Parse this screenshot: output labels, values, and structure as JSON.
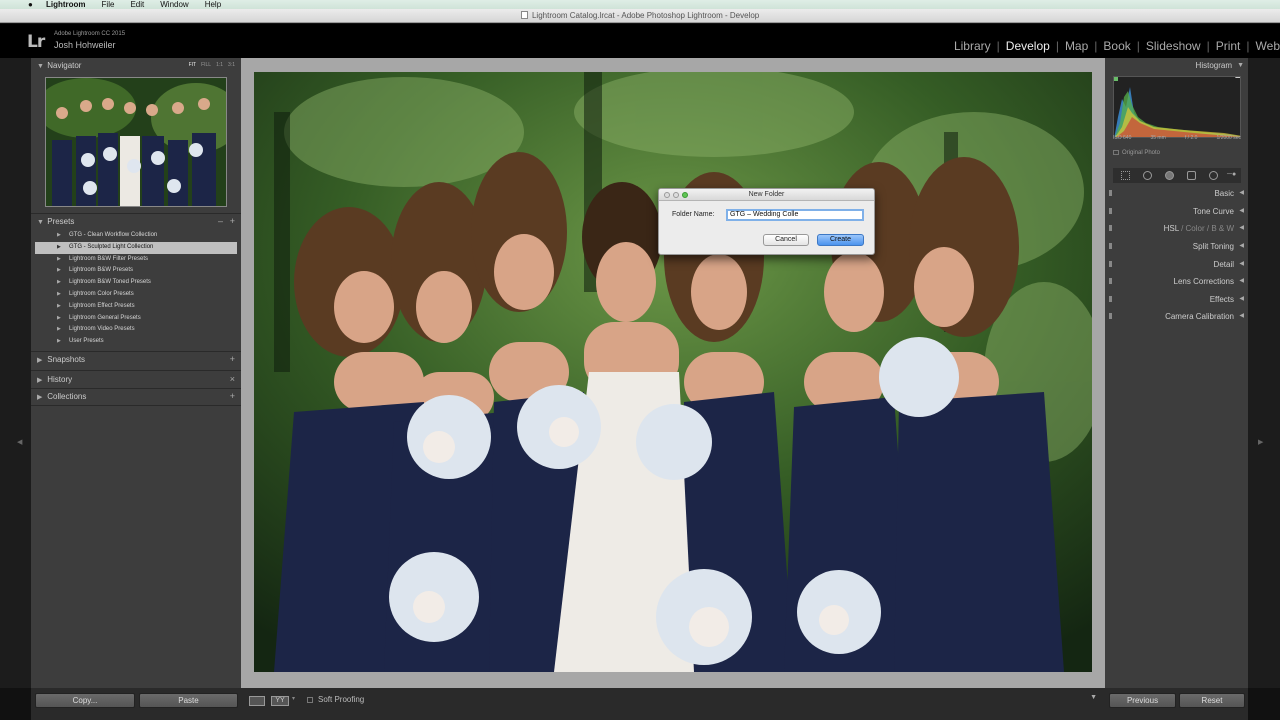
{
  "menubar": {
    "apple": "",
    "app": "Lightroom",
    "items": [
      "File",
      "Edit",
      "Window",
      "Help"
    ]
  },
  "window": {
    "title": "Lightroom Catalog.lrcat - Adobe Photoshop Lightroom - Develop"
  },
  "identity": {
    "logo": "Lr",
    "product": "Adobe Lightroom CC 2015",
    "user": "Josh Hohweiler"
  },
  "modules": [
    "Library",
    "Develop",
    "Map",
    "Book",
    "Slideshow",
    "Print",
    "Web"
  ],
  "active_module": "Develop",
  "left_panel": {
    "navigator": {
      "title": "Navigator",
      "zoom": [
        "FIT",
        "FILL",
        "1:1",
        "3:1"
      ]
    },
    "presets": {
      "title": "Presets",
      "minus": "–",
      "plus": "+",
      "items": [
        {
          "label": "GTG - Clean Workflow Collection"
        },
        {
          "label": "GTG - Sculpted Light Collection",
          "selected": true
        },
        {
          "label": "Lightroom B&W Filter Presets"
        },
        {
          "label": "Lightroom B&W Presets"
        },
        {
          "label": "Lightroom B&W Toned Presets"
        },
        {
          "label": "Lightroom Color Presets"
        },
        {
          "label": "Lightroom Effect Presets"
        },
        {
          "label": "Lightroom General Presets"
        },
        {
          "label": "Lightroom Video Presets"
        },
        {
          "label": "User Presets"
        }
      ]
    },
    "snapshots": {
      "title": "Snapshots",
      "action": "+"
    },
    "history": {
      "title": "History",
      "action": "×"
    },
    "collections": {
      "title": "Collections",
      "action": "+"
    },
    "copy_button": "Copy...",
    "paste_button": "Paste"
  },
  "toolbar": {
    "view_icon": "loupe-view-icon",
    "compare_icon": "before-after-icon",
    "compare_label": "YY",
    "soft_proofing": "Soft Proofing"
  },
  "right_panel": {
    "histogram": {
      "title": "Histogram",
      "iso": "ISO 640",
      "focal": "35 mm",
      "aperture": "f / 2.0",
      "shutter": "1/2000 sec",
      "original_photo": "Original Photo"
    },
    "sections": [
      {
        "label": "Basic"
      },
      {
        "label": "Tone Curve"
      },
      {
        "label": "HSL / Color / B & W",
        "parts": [
          "HSL",
          "Color",
          "B & W"
        ]
      },
      {
        "label": "Split Toning"
      },
      {
        "label": "Detail"
      },
      {
        "label": "Lens Corrections"
      },
      {
        "label": "Effects"
      },
      {
        "label": "Camera Calibration"
      }
    ],
    "previous_button": "Previous",
    "reset_button": "Reset"
  },
  "dialog": {
    "title": "New Folder",
    "folder_label": "Folder Name:",
    "folder_value": "GTG – Wedding Colle",
    "cancel": "Cancel",
    "create": "Create"
  },
  "colors": {
    "panel": "#3d3d3d",
    "selected_row": "#bfbfbf",
    "dress_navy": "#1c2547",
    "foliage": "#2f5422",
    "create_button": "#4b93ee"
  }
}
